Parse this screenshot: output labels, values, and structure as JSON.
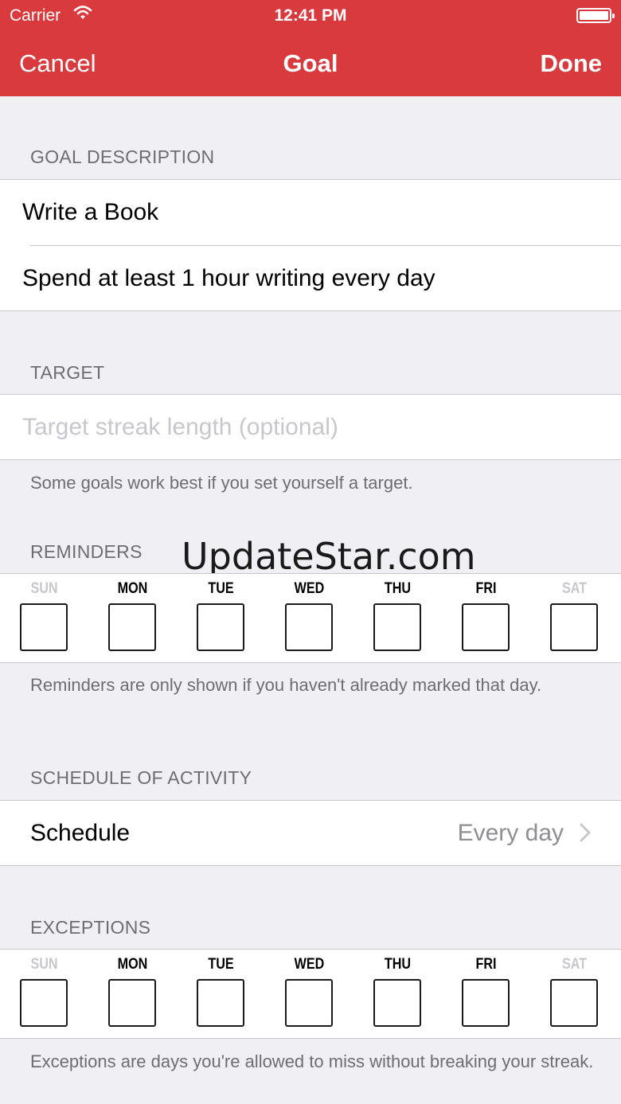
{
  "status_bar": {
    "carrier": "Carrier",
    "time": "12:41 PM"
  },
  "nav": {
    "cancel": "Cancel",
    "title": "Goal",
    "done": "Done"
  },
  "goal_description": {
    "header": "GOAL DESCRIPTION",
    "name": "Write a Book",
    "details": "Spend at least 1 hour writing every day"
  },
  "target": {
    "header": "TARGET",
    "placeholder": "Target streak length (optional)",
    "footer": "Some goals work best if you set yourself a target."
  },
  "reminders": {
    "header": "REMINDERS",
    "days": [
      "SUN",
      "MON",
      "TUE",
      "WED",
      "THU",
      "FRI",
      "SAT"
    ],
    "footer": "Reminders are only shown if you haven't already marked that day."
  },
  "schedule": {
    "header": "SCHEDULE OF ACTIVITY",
    "label": "Schedule",
    "value": "Every day"
  },
  "exceptions": {
    "header": "EXCEPTIONS",
    "days": [
      "SUN",
      "MON",
      "TUE",
      "WED",
      "THU",
      "FRI",
      "SAT"
    ],
    "footer": "Exceptions are days you're allowed to miss without breaking your streak."
  },
  "watermark": "UpdateStar.com",
  "colors": {
    "accent": "#d93a3e",
    "background": "#efeff4",
    "secondary_text": "#6d6d72",
    "placeholder": "#c7c7cd"
  }
}
